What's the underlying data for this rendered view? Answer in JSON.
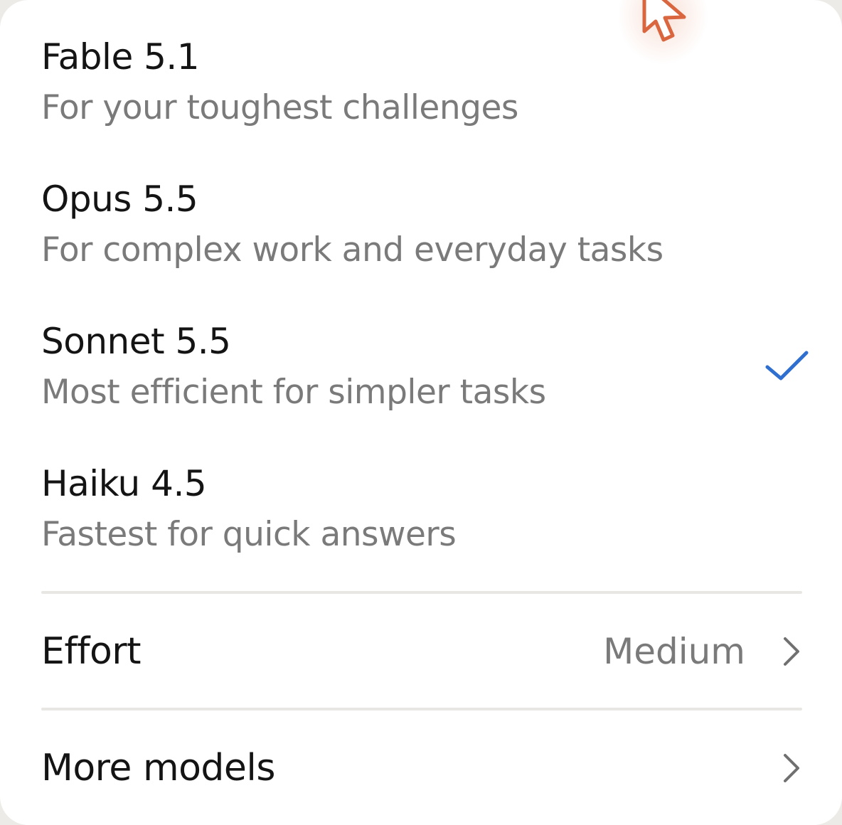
{
  "models": [
    {
      "name": "Fable 5.1",
      "description": "For your toughest challenges",
      "selected": false
    },
    {
      "name": "Opus 5.5",
      "description": "For complex work and everyday tasks",
      "selected": false
    },
    {
      "name": "Sonnet 5.5",
      "description": "Most efficient for simpler tasks",
      "selected": true
    },
    {
      "name": "Haiku 4.5",
      "description": "Fastest for quick answers",
      "selected": false
    }
  ],
  "effort": {
    "label": "Effort",
    "value": "Medium"
  },
  "more_models": {
    "label": "More models"
  },
  "icons": {
    "selected": "checkmark-icon",
    "submenu": "chevron-right-icon",
    "pointer": "mouse-cursor-icon"
  },
  "colors": {
    "checkmark": "#2f6fd0",
    "cursor": "#d9663e",
    "primary_text": "#141414",
    "secondary_text": "#7a7a7a"
  }
}
